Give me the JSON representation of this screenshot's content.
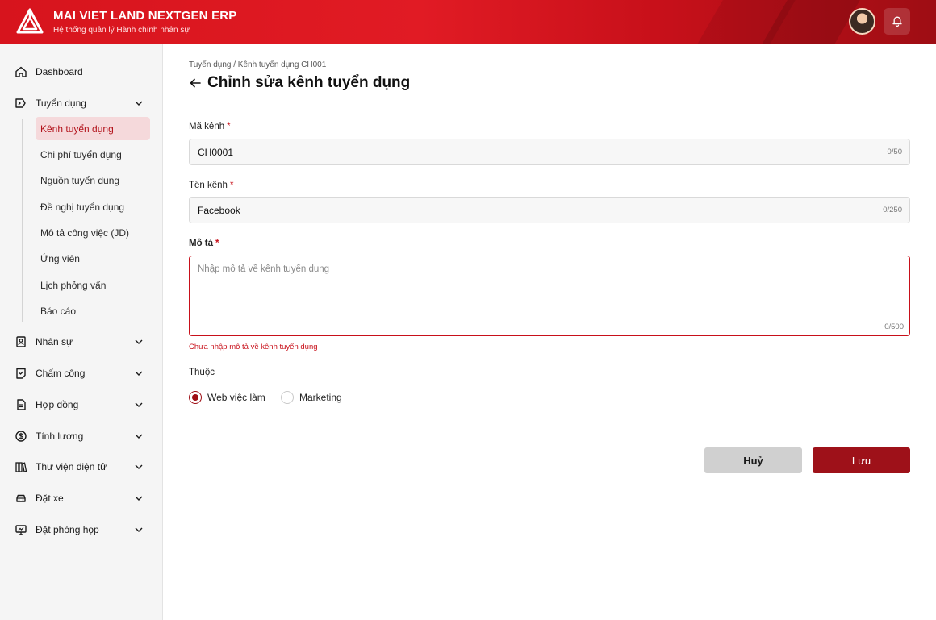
{
  "header": {
    "title": "MAI VIET LAND NEXTGEN ERP",
    "subtitle": "Hệ thống quản lý Hành chính nhân sự"
  },
  "sidebar": {
    "items": [
      {
        "label": "Dashboard",
        "icon": "home-icon"
      },
      {
        "label": "Tuyển dụng",
        "icon": "recruit-icon",
        "expanded": true
      },
      {
        "label": "Nhân sự",
        "icon": "personnel-icon"
      },
      {
        "label": "Chấm công",
        "icon": "timesheet-icon"
      },
      {
        "label": "Hợp đồng",
        "icon": "contract-icon"
      },
      {
        "label": "Tính lương",
        "icon": "salary-icon"
      },
      {
        "label": "Thư viện điện tử",
        "icon": "library-icon"
      },
      {
        "label": "Đặt xe",
        "icon": "car-icon"
      },
      {
        "label": "Đặt phòng họp",
        "icon": "meeting-room-icon"
      }
    ],
    "subitems": [
      "Kênh tuyển dụng",
      "Chi phí tuyển dụng",
      "Nguồn tuyển dụng",
      "Đề nghị tuyển dụng",
      "Mô tả công việc (JD)",
      "Ứng viên",
      "Lịch phỏng vấn",
      "Báo cáo"
    ],
    "active_subitem": "Kênh tuyển dụng"
  },
  "main": {
    "breadcrumb": "Tuyển dụng / Kênh tuyển dụng CH001",
    "title": "Chỉnh sửa kênh tuyển dụng",
    "form": {
      "code_label": "Mã kênh",
      "code_value": "CH0001",
      "code_counter": "0/50",
      "name_label": "Tên kênh",
      "name_value": "Facebook",
      "name_counter": "0/250",
      "desc_label": "Mô tả",
      "desc_placeholder": "Nhập mô tả về kênh tuyển dụng",
      "desc_counter": "0/500",
      "desc_error": "Chưa nhập mô tả về kênh tuyển dụng",
      "required_mark": "*",
      "belongs_label": "Thuộc",
      "belongs_options": [
        "Web việc làm",
        "Marketing"
      ],
      "belongs_selected": "Web việc làm"
    },
    "buttons": {
      "cancel": "Huỷ",
      "save": "Lưu"
    }
  },
  "colors": {
    "brand": "#d7141d",
    "brand_dark": "#9e1119",
    "active_bg": "#f5d9db",
    "error": "#c8101a"
  }
}
